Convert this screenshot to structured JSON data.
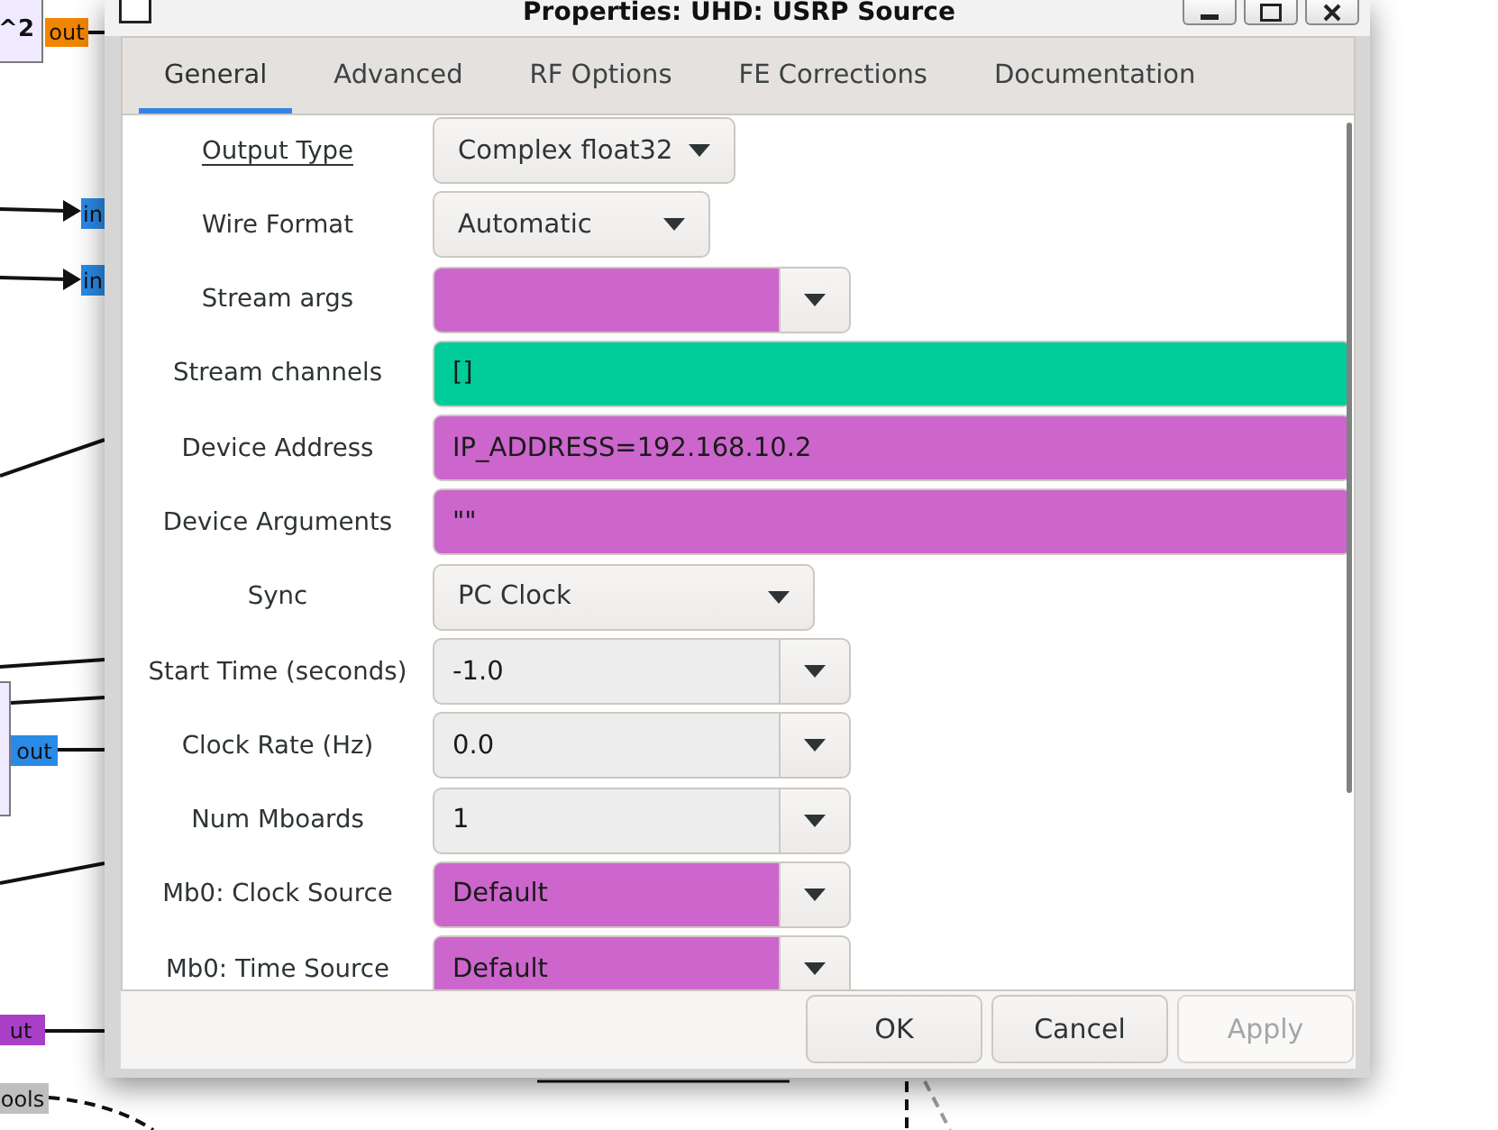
{
  "canvas": {
    "blocks": [
      {
        "label": "^2"
      }
    ],
    "ports": [
      {
        "label": "out",
        "color": "#f28500"
      },
      {
        "label": "in",
        "color": "#2a8ae6"
      },
      {
        "label": "in",
        "color": "#2a8ae6"
      },
      {
        "label": "out",
        "color": "#2a8ae6"
      },
      {
        "label": "ut",
        "color": "#a83fc6"
      },
      {
        "label": "ools",
        "color": "#bfbfbf"
      }
    ]
  },
  "window": {
    "title": "Properties: UHD: USRP Source"
  },
  "tabs": [
    {
      "label": "General",
      "selected": true
    },
    {
      "label": "Advanced",
      "selected": false
    },
    {
      "label": "RF Options",
      "selected": false
    },
    {
      "label": "FE Corrections",
      "selected": false
    },
    {
      "label": "Documentation",
      "selected": false
    }
  ],
  "fields": [
    {
      "label": "Output Type",
      "underlined": true,
      "kind": "dropdown",
      "value": "Complex float32"
    },
    {
      "label": "Wire Format",
      "underlined": false,
      "kind": "dropdown",
      "value": "Automatic"
    },
    {
      "label": "Stream args",
      "underlined": false,
      "kind": "combo",
      "color": "#cc66cc"
    },
    {
      "label": "Stream channels",
      "underlined": false,
      "kind": "entry",
      "value": "[]",
      "color": "#00cc99"
    },
    {
      "label": "Device Address",
      "underlined": false,
      "kind": "entry",
      "value": "IP_ADDRESS=192.168.10.2",
      "color": "#cc66cc"
    },
    {
      "label": "Device Arguments",
      "underlined": false,
      "kind": "entry",
      "value": "\"\"",
      "color": "#cc66cc"
    },
    {
      "label": "Sync",
      "underlined": false,
      "kind": "dropdown",
      "value": "PC Clock"
    },
    {
      "label": "Start Time (seconds)",
      "underlined": false,
      "kind": "combo",
      "value": "-1.0",
      "color": "#ededed"
    },
    {
      "label": "Clock Rate (Hz)",
      "underlined": false,
      "kind": "combo",
      "value": "0.0",
      "color": "#ededed"
    },
    {
      "label": "Num Mboards",
      "underlined": false,
      "kind": "combo",
      "value": "1",
      "color": "#ededed"
    },
    {
      "label": "Mb0: Clock Source",
      "underlined": false,
      "kind": "combo",
      "value": "Default",
      "color": "#cc66cc"
    },
    {
      "label": "Mb0: Time Source",
      "underlined": false,
      "kind": "combo",
      "value": "Default",
      "color": "#cc66cc"
    }
  ],
  "buttons": [
    {
      "label": "OK",
      "disabled": false
    },
    {
      "label": "Cancel",
      "disabled": false
    },
    {
      "label": "Apply",
      "disabled": true
    }
  ]
}
